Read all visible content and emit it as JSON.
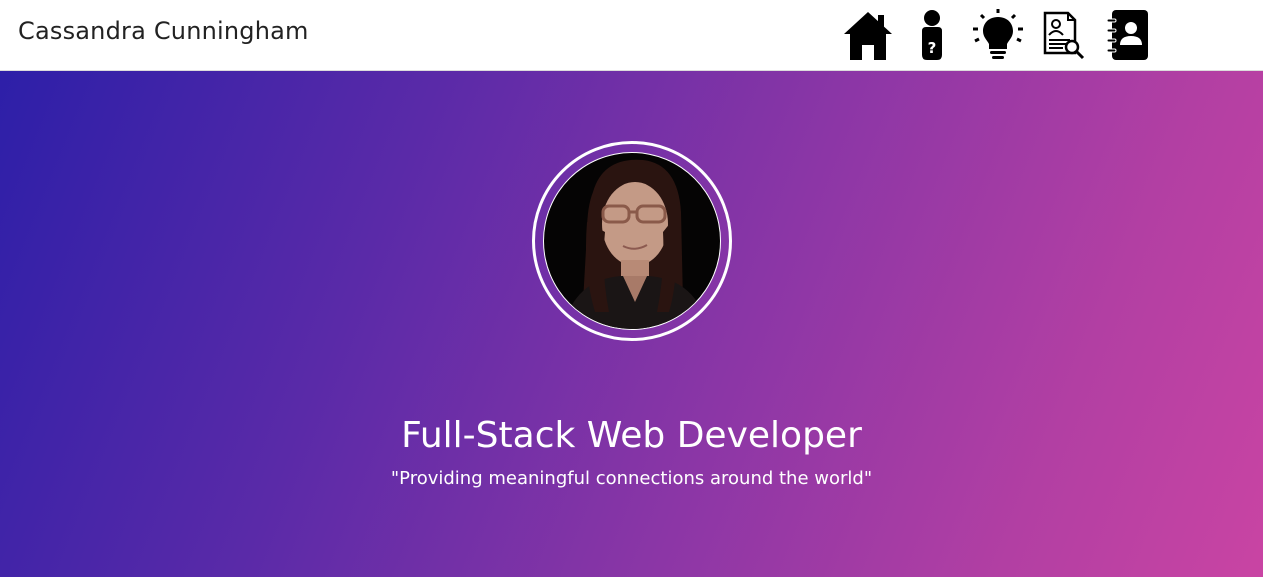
{
  "header": {
    "brand": "Cassandra Cunningham"
  },
  "nav": {
    "items": [
      {
        "icon": "home-icon"
      },
      {
        "icon": "person-question-icon"
      },
      {
        "icon": "lightbulb-icon"
      },
      {
        "icon": "resume-search-icon"
      },
      {
        "icon": "contact-book-icon"
      }
    ]
  },
  "hero": {
    "title": "Full-Stack Web Developer",
    "tagline": "\"Providing meaningful connections around the world\"",
    "gradient_start": "#2d1fa8",
    "gradient_end": "#c944a3"
  }
}
